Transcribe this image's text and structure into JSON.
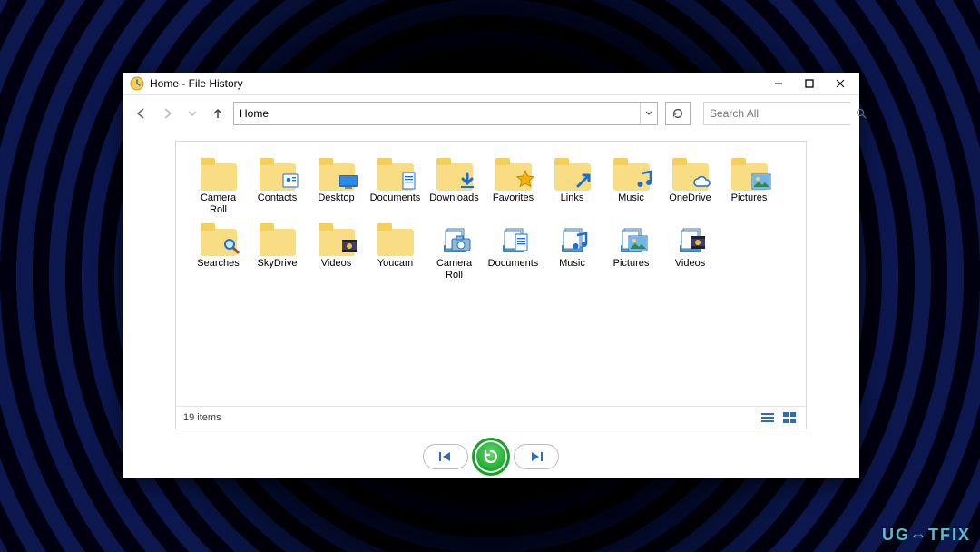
{
  "window": {
    "title": "Home - File History",
    "minimize": "–",
    "maximize": "□",
    "close": "×"
  },
  "toolbar": {
    "address": "Home",
    "search_placeholder": "Search All"
  },
  "items": [
    {
      "label": "Camera Roll",
      "icon": "folder",
      "overlay": "none"
    },
    {
      "label": "Contacts",
      "icon": "folder",
      "overlay": "contact"
    },
    {
      "label": "Desktop",
      "icon": "folder",
      "overlay": "desktop"
    },
    {
      "label": "Documents",
      "icon": "folder",
      "overlay": "doc"
    },
    {
      "label": "Downloads",
      "icon": "folder",
      "overlay": "download"
    },
    {
      "label": "Favorites",
      "icon": "folder",
      "overlay": "star"
    },
    {
      "label": "Links",
      "icon": "folder",
      "overlay": "link"
    },
    {
      "label": "Music",
      "icon": "folder",
      "overlay": "music"
    },
    {
      "label": "OneDrive",
      "icon": "folder",
      "overlay": "cloud"
    },
    {
      "label": "Pictures",
      "icon": "folder",
      "overlay": "picture"
    },
    {
      "label": "Searches",
      "icon": "folder",
      "overlay": "search"
    },
    {
      "label": "SkyDrive",
      "icon": "folder",
      "overlay": "none"
    },
    {
      "label": "Videos",
      "icon": "folder",
      "overlay": "video"
    },
    {
      "label": "Youcam",
      "icon": "folder",
      "overlay": "none"
    },
    {
      "label": "Camera Roll",
      "icon": "library",
      "overlay": "camera"
    },
    {
      "label": "Documents",
      "icon": "library",
      "overlay": "doc"
    },
    {
      "label": "Music",
      "icon": "library",
      "overlay": "music"
    },
    {
      "label": "Pictures",
      "icon": "library",
      "overlay": "picture"
    },
    {
      "label": "Videos",
      "icon": "library",
      "overlay": "video"
    }
  ],
  "status": {
    "count_text": "19 items"
  },
  "watermark": "UG⇔TFIX"
}
